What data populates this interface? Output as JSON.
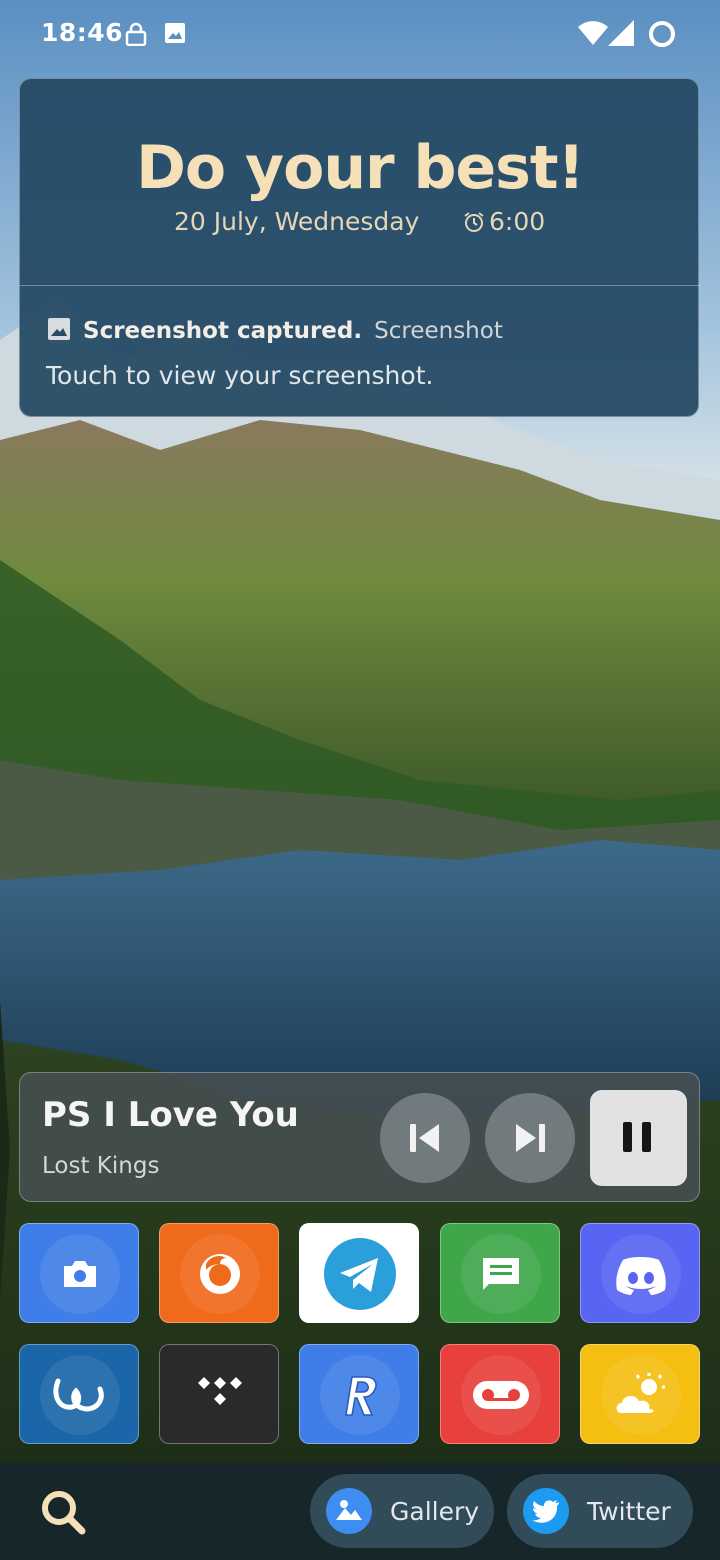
{
  "status_bar": {
    "time": "18:46",
    "icons_left": [
      "lock-icon",
      "image-icon"
    ],
    "icons_right": [
      "wifi-icon",
      "signal-icon",
      "ring-icon"
    ]
  },
  "top_card": {
    "title": "Do your best!",
    "date": "20 July, Wednesday",
    "alarm": "6:00",
    "notification": {
      "icon": "image-icon",
      "title": "Screenshot captured.",
      "app": "Screenshot",
      "body": "Touch to view your screenshot."
    }
  },
  "media": {
    "song": "PS I Love You",
    "artist": "Lost Kings",
    "controls": [
      "previous",
      "next",
      "pause"
    ]
  },
  "apps": [
    {
      "name": "camera",
      "color": "#3f7ee8"
    },
    {
      "name": "firefox",
      "color": "#f06a1c"
    },
    {
      "name": "telegram",
      "color": "#ffffff"
    },
    {
      "name": "messages",
      "color": "#3fa74a"
    },
    {
      "name": "discord",
      "color": "#5865f2"
    },
    {
      "name": "lynket",
      "color": "#1a66a8"
    },
    {
      "name": "tidal",
      "color": "#2a2a2a"
    },
    {
      "name": "revolut",
      "color": "#3f7ee8"
    },
    {
      "name": "voicemail",
      "color": "#e8403c"
    },
    {
      "name": "weather",
      "color": "#f5bf12"
    }
  ],
  "dock": {
    "search_icon": "search-icon",
    "shortcuts": [
      {
        "label": "Gallery",
        "icon": "gallery-icon",
        "color": "#3d8ef0"
      },
      {
        "label": "Twitter",
        "icon": "twitter-icon",
        "color": "#1d9bf0"
      }
    ]
  }
}
